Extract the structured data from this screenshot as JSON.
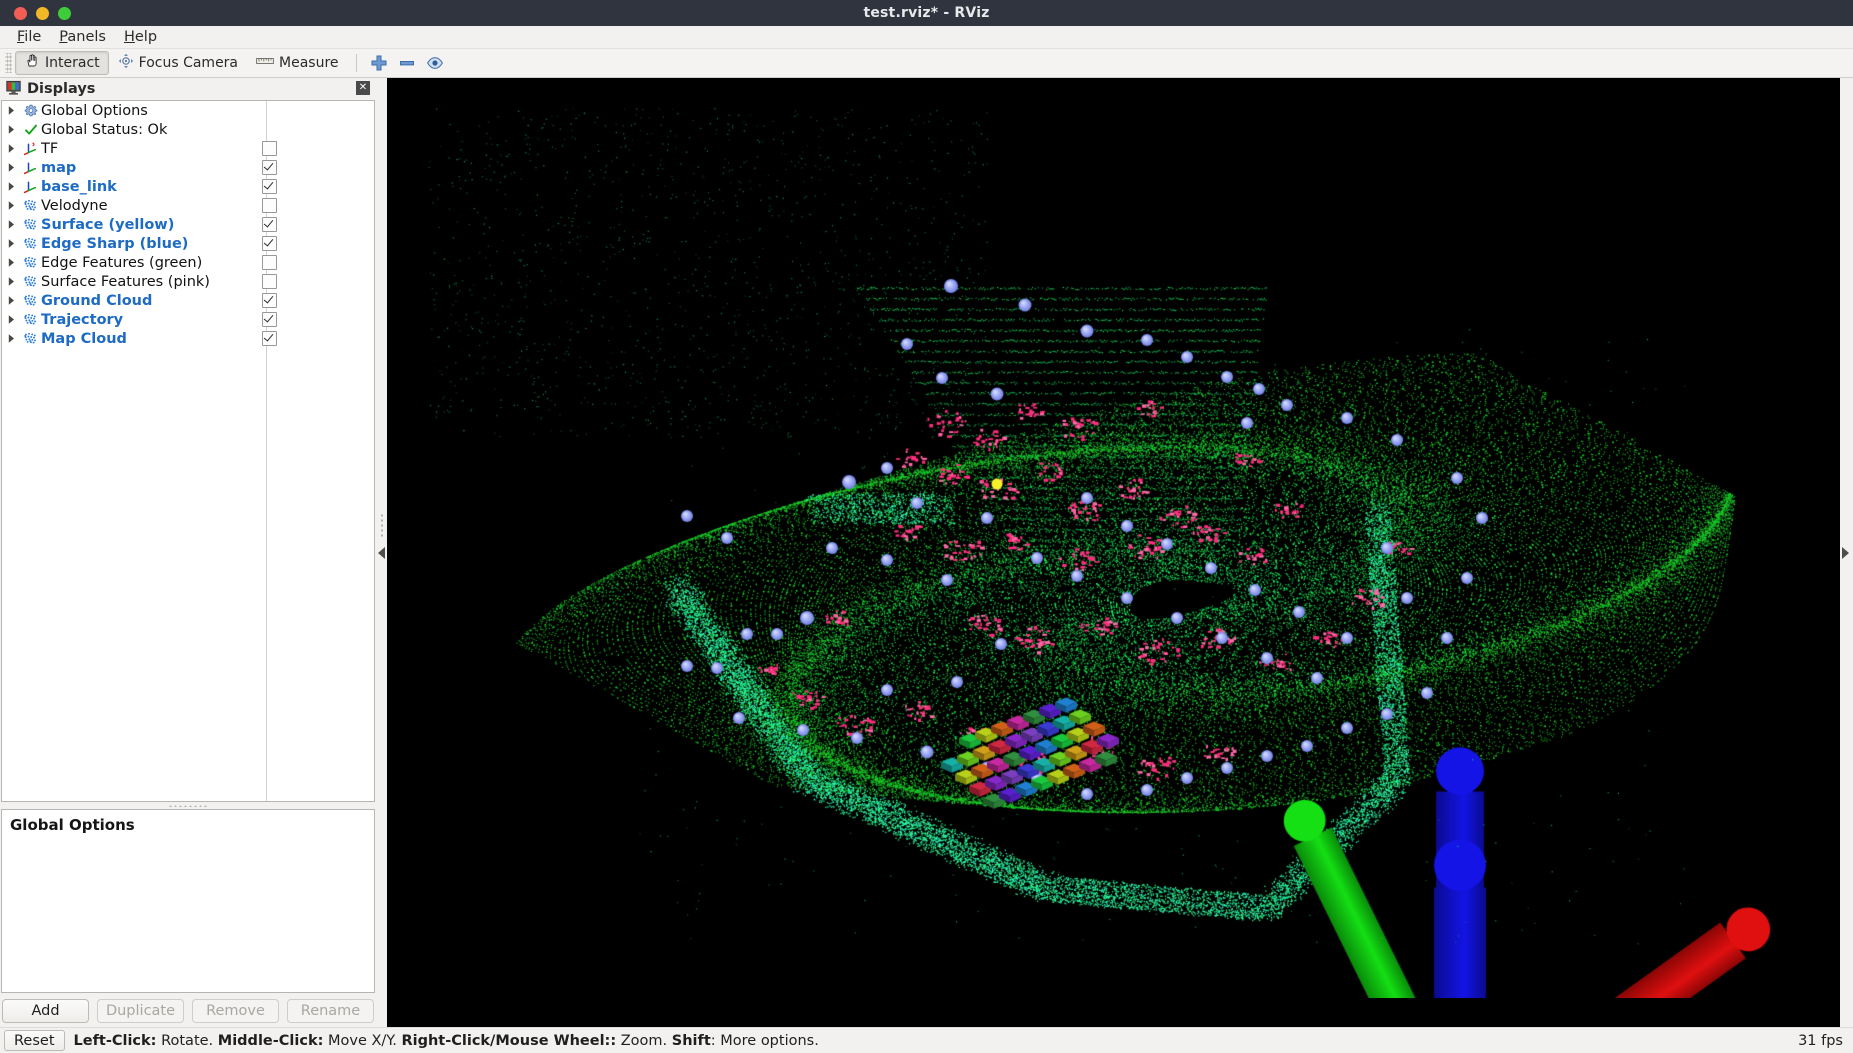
{
  "window": {
    "title": "test.rviz* - RViz",
    "controls": {
      "close": "close",
      "minimize": "minimize",
      "maximize": "maximize"
    }
  },
  "menubar": {
    "items": [
      {
        "label": "File",
        "mnemonic": "F"
      },
      {
        "label": "Panels",
        "mnemonic": "P"
      },
      {
        "label": "Help",
        "mnemonic": "H"
      }
    ]
  },
  "toolbar": {
    "tools": [
      {
        "label": "Interact",
        "icon": "hand-cursor-icon",
        "checked": true
      },
      {
        "label": "Focus Camera",
        "icon": "focus-camera-icon",
        "checked": false
      },
      {
        "label": "Measure",
        "icon": "ruler-icon",
        "checked": false
      }
    ],
    "icon_buttons": [
      {
        "name": "add-pose-estimate-icon",
        "glyph": "plus"
      },
      {
        "name": "remove-tool-icon",
        "glyph": "minus"
      },
      {
        "name": "publish-point-icon",
        "glyph": "eye"
      }
    ]
  },
  "displays_panel": {
    "title": "Displays",
    "title_icon": "displays-monitor-icon",
    "close_label": "✕",
    "items": [
      {
        "label": "Global Options",
        "icon": "gear-icon",
        "enabled": false,
        "checkbox": "none",
        "expandable": true
      },
      {
        "label": "Global Status: Ok",
        "icon": "check-ok-icon",
        "enabled": false,
        "checkbox": "none",
        "expandable": true
      },
      {
        "label": "TF",
        "icon": "tf-axes-icon",
        "enabled": false,
        "checkbox": "unchecked",
        "expandable": true
      },
      {
        "label": "map",
        "icon": "axes-icon",
        "enabled": true,
        "checkbox": "checked",
        "expandable": true
      },
      {
        "label": "base_link",
        "icon": "axes-icon",
        "enabled": true,
        "checkbox": "checked",
        "expandable": true
      },
      {
        "label": "Velodyne",
        "icon": "pointcloud-icon",
        "enabled": false,
        "checkbox": "unchecked",
        "expandable": true
      },
      {
        "label": "Surface (yellow)",
        "icon": "pointcloud-icon",
        "enabled": true,
        "checkbox": "checked",
        "expandable": true
      },
      {
        "label": "Edge Sharp (blue)",
        "icon": "pointcloud-icon",
        "enabled": true,
        "checkbox": "checked",
        "expandable": true
      },
      {
        "label": "Edge Features (green)",
        "icon": "pointcloud-icon",
        "enabled": false,
        "checkbox": "unchecked",
        "expandable": true
      },
      {
        "label": "Surface Features (pink)",
        "icon": "pointcloud-icon",
        "enabled": false,
        "checkbox": "unchecked",
        "expandable": true
      },
      {
        "label": "Ground Cloud",
        "icon": "pointcloud-icon",
        "enabled": true,
        "checkbox": "checked",
        "expandable": true
      },
      {
        "label": "Trajectory",
        "icon": "pointcloud-icon",
        "enabled": true,
        "checkbox": "checked",
        "expandable": true
      },
      {
        "label": "Map Cloud",
        "icon": "pointcloud-icon",
        "enabled": true,
        "checkbox": "checked",
        "expandable": true
      }
    ]
  },
  "properties_panel": {
    "title": "Global Options"
  },
  "display_buttons": [
    {
      "label": "Add",
      "disabled": false
    },
    {
      "label": "Duplicate",
      "disabled": true
    },
    {
      "label": "Remove",
      "disabled": true
    },
    {
      "label": "Rename",
      "disabled": true
    }
  ],
  "statusbar": {
    "reset_label": "Reset",
    "hint_segments": [
      {
        "text": "Left-Click:",
        "bold": true
      },
      {
        "text": " Rotate. ",
        "bold": false
      },
      {
        "text": "Middle-Click:",
        "bold": true
      },
      {
        "text": " Move X/Y. ",
        "bold": false
      },
      {
        "text": "Right-Click/Mouse Wheel::",
        "bold": true
      },
      {
        "text": " Zoom. ",
        "bold": false
      },
      {
        "text": "Shift",
        "bold": true
      },
      {
        "text": ": More options.",
        "bold": false
      }
    ],
    "fps": "31 fps"
  },
  "viewport": {
    "background_color": "#000000",
    "collapse_left_icon": "collapse-left-arrow-icon",
    "collapse_right_icon": "collapse-right-arrow-icon",
    "scene": {
      "axis_colors": {
        "x": "#e01010",
        "y": "#14e014",
        "z": "#1414e6"
      },
      "cloud_colors": {
        "ground": "#14dd55",
        "map": "#0bc979",
        "edge_sharp": "#8f9bf0",
        "surface_features": "#ff2e7e",
        "surface_yellow": "#f5f128"
      }
    }
  }
}
